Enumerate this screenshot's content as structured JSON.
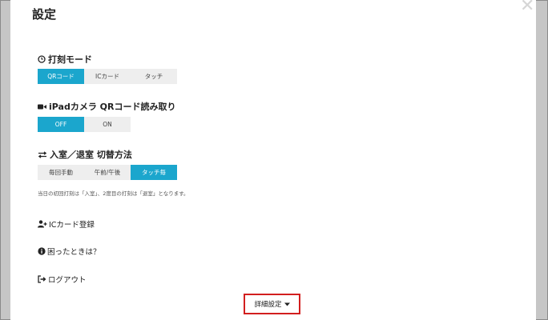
{
  "dialog": {
    "title": "設定",
    "close_icon": "close-icon"
  },
  "punch_mode": {
    "label": "打刻モード",
    "options": [
      "QRコード",
      "ICカード",
      "タッチ"
    ],
    "selected": "QRコード"
  },
  "ipad_camera": {
    "label": "iPadカメラ QRコード読み取り",
    "options": [
      "OFF",
      "ON"
    ],
    "selected": "OFF"
  },
  "switch_method": {
    "label": "入室／退室 切替方法",
    "options": [
      "毎回手動",
      "午前/午後",
      "タッチ毎"
    ],
    "selected": "タッチ毎",
    "note": "当日の初回打刻は「入室」、2度目の打刻は「退室」となります。"
  },
  "links": {
    "ic_register": "ICカード登録",
    "help": "困ったときは？",
    "logout": "ログアウト"
  },
  "detail_button": {
    "label": "詳細設定"
  },
  "colors": {
    "accent": "#1ba6cd",
    "highlight": "#d21e1e"
  }
}
